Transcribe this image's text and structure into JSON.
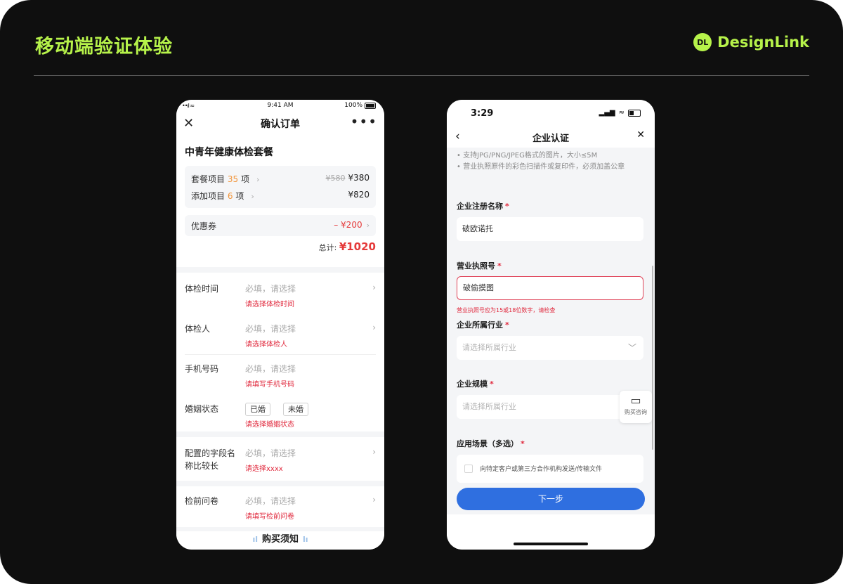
{
  "header": {
    "title": "移动端验证体验",
    "brand_logo": "DL",
    "brand_name": "DesignLink",
    "accent": "#b6f24a"
  },
  "left_phone": {
    "status": {
      "signal": "••ıl ≈",
      "time": "9:41 AM",
      "battery": "100%"
    },
    "nav": {
      "close": "✕",
      "title": "确认订单",
      "more": "•••"
    },
    "package_title": "中青年健康体检套餐",
    "items": [
      {
        "label": "套餐项目",
        "count": "35",
        "unit": "项",
        "original": "¥580",
        "price": "¥380"
      },
      {
        "label": "添加项目",
        "count": "6",
        "unit": "项",
        "price": "¥820"
      }
    ],
    "coupon": {
      "label": "优惠券",
      "value": "– ¥200"
    },
    "total": {
      "label": "总计:",
      "amount": "¥1020"
    },
    "form": [
      {
        "label": "体检时间",
        "placeholder": "必填，请选择",
        "error": "请选择体检时间"
      },
      {
        "label": "体检人",
        "placeholder": "必填，请选择",
        "error": "请选择体检人"
      },
      {
        "label": "手机号码",
        "placeholder": "必填，请选择",
        "error": "请填写手机号码"
      },
      {
        "label": "婚姻状态",
        "options": [
          "已婚",
          "未婚"
        ],
        "error": "请选择婚姻状态"
      },
      {
        "label_line1": "配置的字段名",
        "label_line2": "称比较长",
        "placeholder": "必填，请选择",
        "error": "请选择xxxx"
      },
      {
        "label": "检前问卷",
        "placeholder": "必填，请选择",
        "error": "请填写检前问卷"
      }
    ],
    "bottom_title": "购买须知"
  },
  "right_phone": {
    "status": {
      "time": "3:29"
    },
    "nav": {
      "back": "‹",
      "title": "企业认证",
      "close": "✕"
    },
    "tips": [
      "• 支持JPG/PNG/JPEG格式的图片，大小≤5M",
      "• 营业执照原件的彩色扫描件或复印件，必须加盖公章"
    ],
    "fields": [
      {
        "label": "企业注册名称",
        "value": "破欧诺托"
      },
      {
        "label": "营业执照号",
        "value": "破偷摸图",
        "error": "营业执照号应为15或18位数字，请检查"
      },
      {
        "label": "企业所属行业",
        "placeholder": "请选择所属行业"
      },
      {
        "label": "企业规模",
        "placeholder": "请选择所属行业"
      },
      {
        "label": "应用场景（多选）",
        "option": "向特定客户或第三方合作机构发送/传输文件"
      }
    ],
    "required_mark": "*",
    "float_button": {
      "label": "购买咨询"
    },
    "next_button": "下一步"
  }
}
